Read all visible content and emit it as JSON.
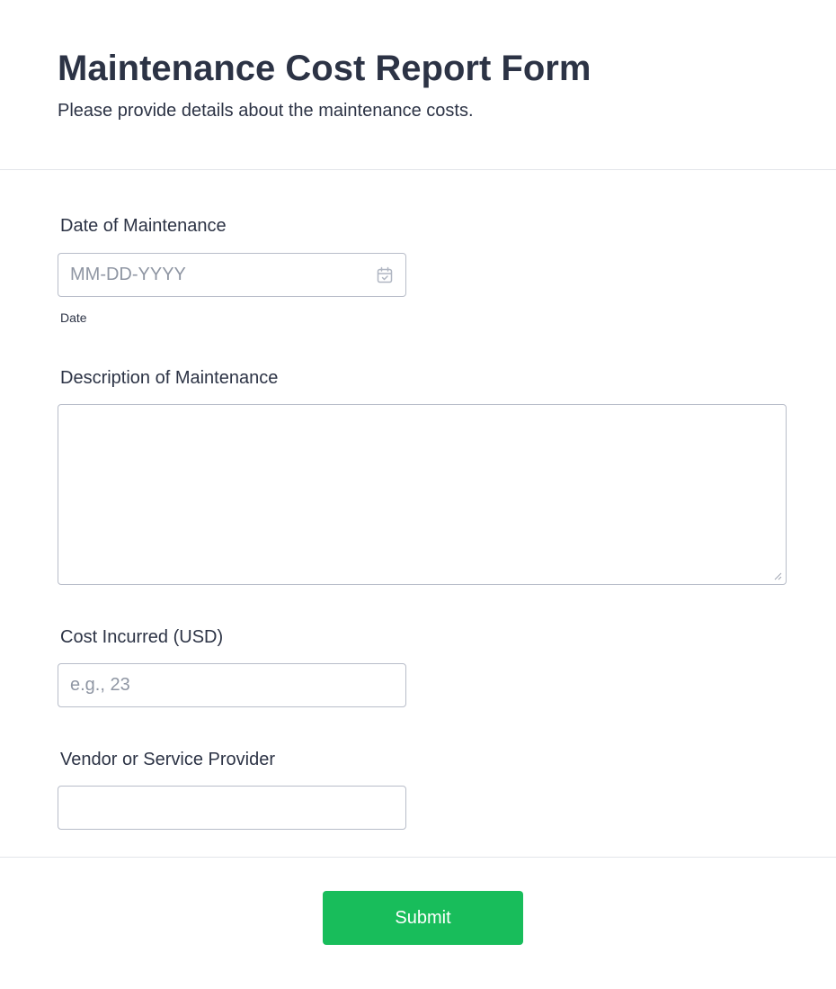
{
  "header": {
    "title": "Maintenance Cost Report Form",
    "subtitle": "Please provide details about the maintenance costs."
  },
  "fields": {
    "date": {
      "label": "Date of Maintenance",
      "placeholder": "MM-DD-YYYY",
      "value": "",
      "sublabel": "Date",
      "icon": "calendar-icon"
    },
    "description": {
      "label": "Description of Maintenance",
      "value": ""
    },
    "cost": {
      "label": "Cost Incurred (USD)",
      "placeholder": "e.g., 23",
      "value": ""
    },
    "vendor": {
      "label": "Vendor or Service Provider",
      "value": ""
    }
  },
  "submit_label": "Submit",
  "colors": {
    "text": "#2c3345",
    "placeholder": "#8f96a3",
    "border": "#b8bdc9",
    "divider": "#e3e5ea",
    "submit_bg": "#18bd5b",
    "submit_text": "#ffffff"
  }
}
